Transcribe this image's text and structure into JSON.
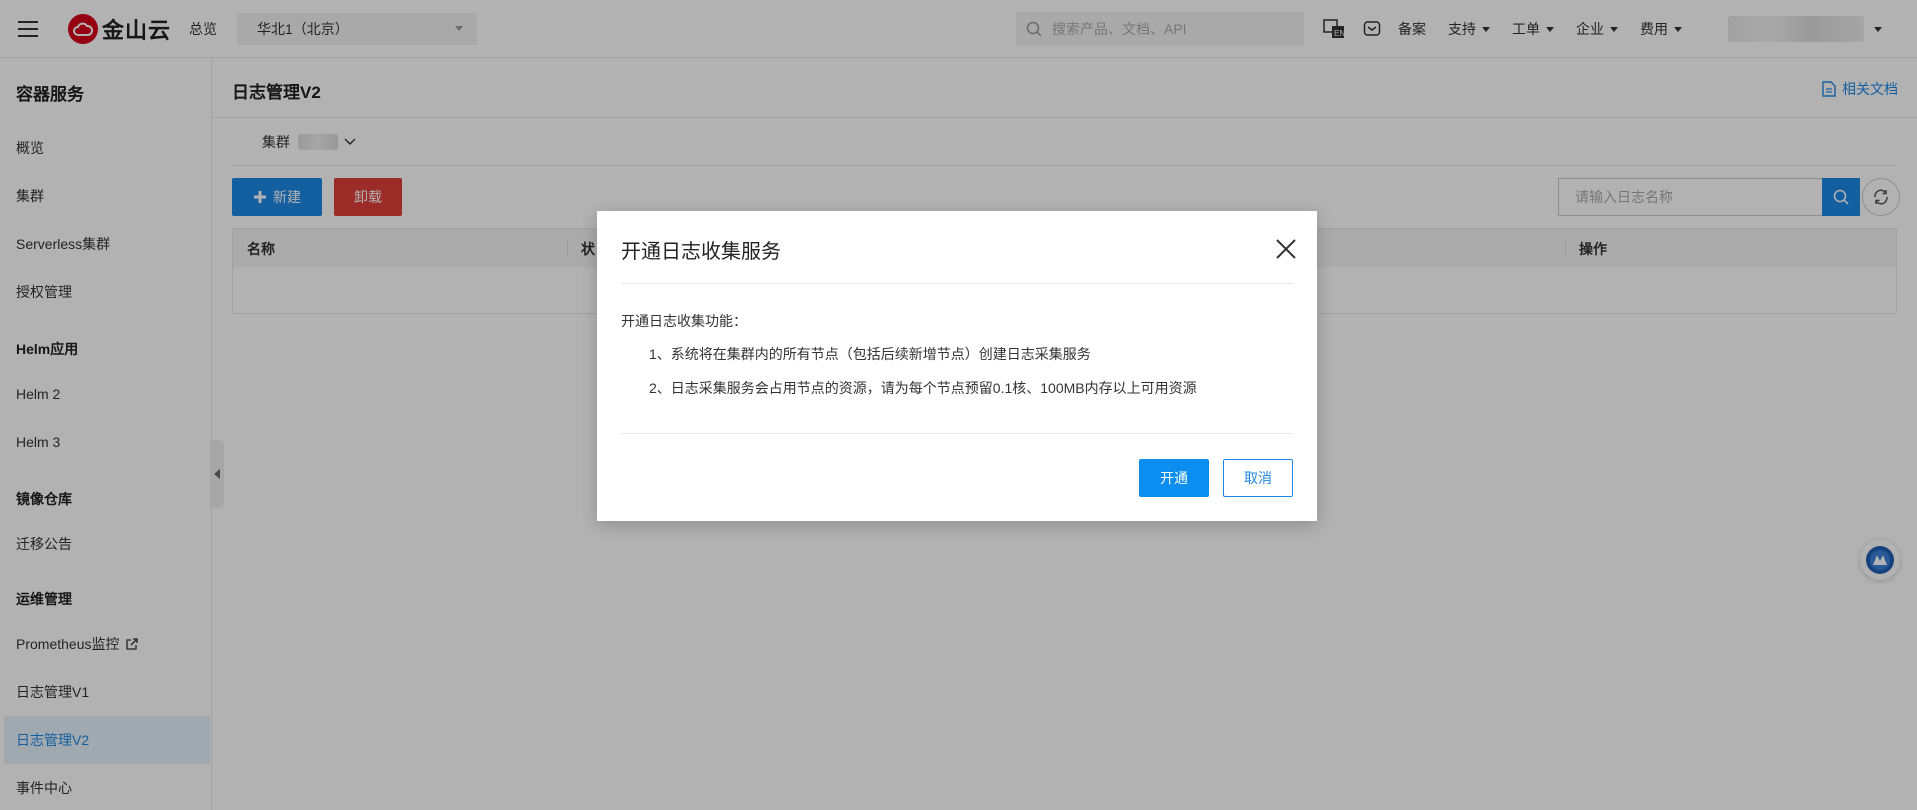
{
  "topbar": {
    "logo_text": "金山云",
    "overview_label": "总览",
    "region": "华北1（北京）",
    "search_placeholder": "搜索产品、文档、API",
    "links": {
      "filing": "备案",
      "support": "支持",
      "ticket": "工单",
      "enterprise": "企业",
      "billing": "费用"
    }
  },
  "sidebar": {
    "title": "容器服务",
    "items": {
      "overview": "概览",
      "cluster": "集群",
      "serverless": "Serverless集群",
      "auth": "授权管理",
      "helm_group": "Helm应用",
      "helm2": "Helm 2",
      "helm3": "Helm 3",
      "registry_group": "镜像仓库",
      "migration": "迁移公告",
      "ops_group": "运维管理",
      "prometheus": "Prometheus监控",
      "log_v1": "日志管理V1",
      "log_v2": "日志管理V2",
      "events": "事件中心"
    }
  },
  "main": {
    "title": "日志管理V2",
    "doc_link": "相关文档",
    "cluster_label": "集群",
    "new_button": "新建",
    "unload_button": "卸载",
    "log_search_placeholder": "请输入日志名称",
    "table_headers": {
      "name": "名称",
      "status": "状",
      "action": "操作"
    }
  },
  "modal": {
    "title": "开通日志收集服务",
    "intro": "开通日志收集功能：",
    "line1": "1、系统将在集群内的所有节点（包括后续新增节点）创建日志采集服务",
    "line2": "2、日志采集服务会占用节点的资源，请为每个节点预留0.1核、100MB内存以上可用资源",
    "confirm_button": "开通",
    "cancel_button": "取消"
  },
  "colors": {
    "accent": "#1e88e5",
    "danger": "#e0403a",
    "brand": "#d6001c"
  }
}
